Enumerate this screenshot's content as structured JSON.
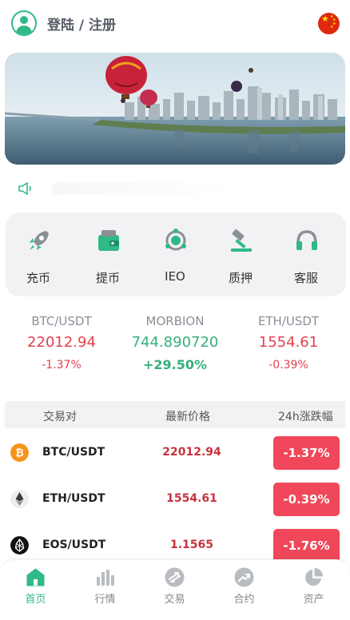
{
  "header": {
    "login_label": "登陆 / 注册"
  },
  "quick_menu": [
    {
      "label": "充币",
      "icon": "rocket-icon"
    },
    {
      "label": "提币",
      "icon": "wallet-icon"
    },
    {
      "label": "IEO",
      "icon": "ieo-icon"
    },
    {
      "label": "质押",
      "icon": "gavel-icon"
    },
    {
      "label": "客服",
      "icon": "headset-icon"
    }
  ],
  "tickers": [
    {
      "name": "BTC/USDT",
      "price": "22012.94",
      "change": "-1.37%"
    },
    {
      "name": "MORBION",
      "price": "744.890720",
      "change": "+29.50%"
    },
    {
      "name": "ETH/USDT",
      "price": "1554.61",
      "change": "-0.39%"
    }
  ],
  "table": {
    "headers": {
      "pair": "交易对",
      "price": "最新价格",
      "change": "24h涨跌幅"
    },
    "rows": [
      {
        "pair": "BTC/USDT",
        "price": "22012.94",
        "change": "-1.37%",
        "icon": "bitcoin-icon"
      },
      {
        "pair": "ETH/USDT",
        "price": "1554.61",
        "change": "-0.39%",
        "icon": "ethereum-icon"
      },
      {
        "pair": "EOS/USDT",
        "price": "1.1565",
        "change": "-1.76%",
        "icon": "eos-icon"
      }
    ]
  },
  "tabbar": [
    {
      "label": "首页",
      "icon": "home-icon",
      "active": true
    },
    {
      "label": "行情",
      "icon": "bar-chart-icon",
      "active": false
    },
    {
      "label": "交易",
      "icon": "exchange-icon",
      "active": false
    },
    {
      "label": "合约",
      "icon": "trend-icon",
      "active": false
    },
    {
      "label": "资产",
      "icon": "pie-chart-icon",
      "active": false
    }
  ],
  "colors": {
    "accent": "#2fb987",
    "down": "#e4404f",
    "up": "#35b07b",
    "badge": "#f0475a"
  }
}
